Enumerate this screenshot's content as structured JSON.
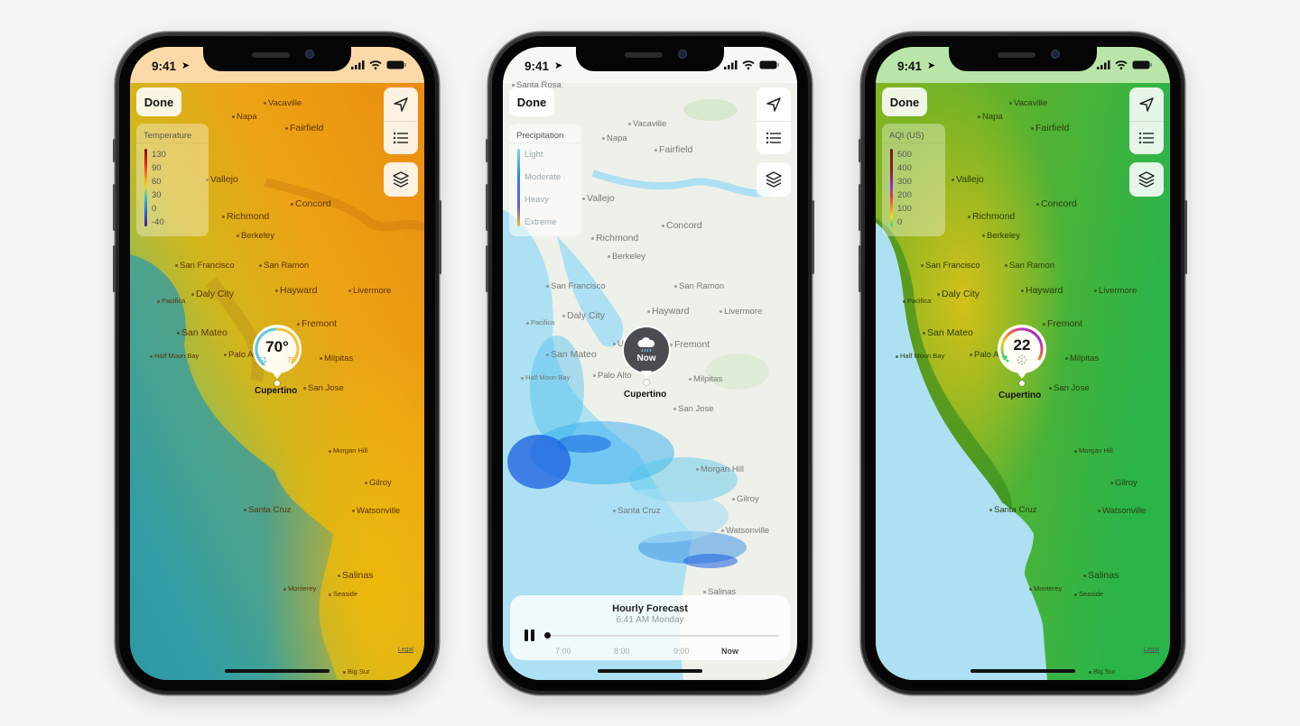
{
  "status_bar": {
    "time": "9:41"
  },
  "phones": [
    {
      "id": "temperature",
      "done_label": "Done",
      "legend": {
        "title": "Temperature",
        "labels": [
          "130",
          "90",
          "60",
          "30",
          "0",
          "-40"
        ]
      },
      "pin": {
        "value": "70°",
        "low": "51",
        "high": "76",
        "location": "Cupertino"
      },
      "legal": "Legal",
      "cities": [
        "Vacaville",
        "Napa",
        "Fairfield",
        "Vallejo",
        "Concord",
        "Richmond",
        "Berkeley",
        "San Francisco",
        "San Ramon",
        "Daly City",
        "Hayward",
        "Livermore",
        "Pacifica",
        "Fremont",
        "San Mateo",
        "Palo Alto",
        "Half Moon Bay",
        "Milpitas",
        "San Jose",
        "Morgan Hill",
        "Gilroy",
        "Santa Cruz",
        "Watsonville",
        "Salinas",
        "Monterey",
        "Seaside",
        "Big Sur"
      ]
    },
    {
      "id": "precipitation",
      "done_label": "Done",
      "legend": {
        "title": "Precipitation",
        "labels": [
          "Light",
          "Moderate",
          "Heavy",
          "Extreme"
        ]
      },
      "pin": {
        "value": "Now",
        "location": "Cupertino"
      },
      "forecast": {
        "title": "Hourly Forecast",
        "subtitle": "6:41 AM Monday",
        "ticks": [
          "7:00",
          "8:00",
          "9:00",
          "Now"
        ],
        "progress": 0
      },
      "cities": [
        "Santa Rosa",
        "Vacaville",
        "Napa",
        "Fairfield",
        "Vallejo",
        "Concord",
        "Richmond",
        "Berkeley",
        "San Francisco",
        "San Ramon",
        "Daly City",
        "Hayward",
        "Livermore",
        "Pacifica",
        "Union City",
        "Fremont",
        "San Mateo",
        "Palo Alto",
        "Half Moon Bay",
        "Milpitas",
        "San Jose",
        "Morgan Hill",
        "Gilroy",
        "Santa Cruz",
        "Watsonville",
        "Salinas"
      ]
    },
    {
      "id": "air-quality",
      "done_label": "Done",
      "legend": {
        "title": "AQI (US)",
        "labels": [
          "500",
          "400",
          "300",
          "200",
          "100",
          "0"
        ]
      },
      "pin": {
        "value": "22",
        "location": "Cupertino"
      },
      "legal": "Legal",
      "cities": [
        "Vacaville",
        "Napa",
        "Fairfield",
        "Vallejo",
        "Concord",
        "Richmond",
        "Berkeley",
        "San Francisco",
        "San Ramon",
        "Daly City",
        "Hayward",
        "Livermore",
        "Pacifica",
        "Fremont",
        "San Mateo",
        "Palo Alto",
        "Half Moon Bay",
        "Milpitas",
        "San Jose",
        "Morgan Hill",
        "Gilroy",
        "Santa Cruz",
        "Watsonville",
        "Salinas",
        "Monterey",
        "Seaside",
        "Big Sur"
      ]
    }
  ],
  "colors": {
    "temp_status": "#fcd9a8",
    "precip_status": "#f6f8f3",
    "aqi_status": "#b9e6a8",
    "ocean_light": "#ace0f2",
    "temp_ocean": "#2f9aa5"
  }
}
